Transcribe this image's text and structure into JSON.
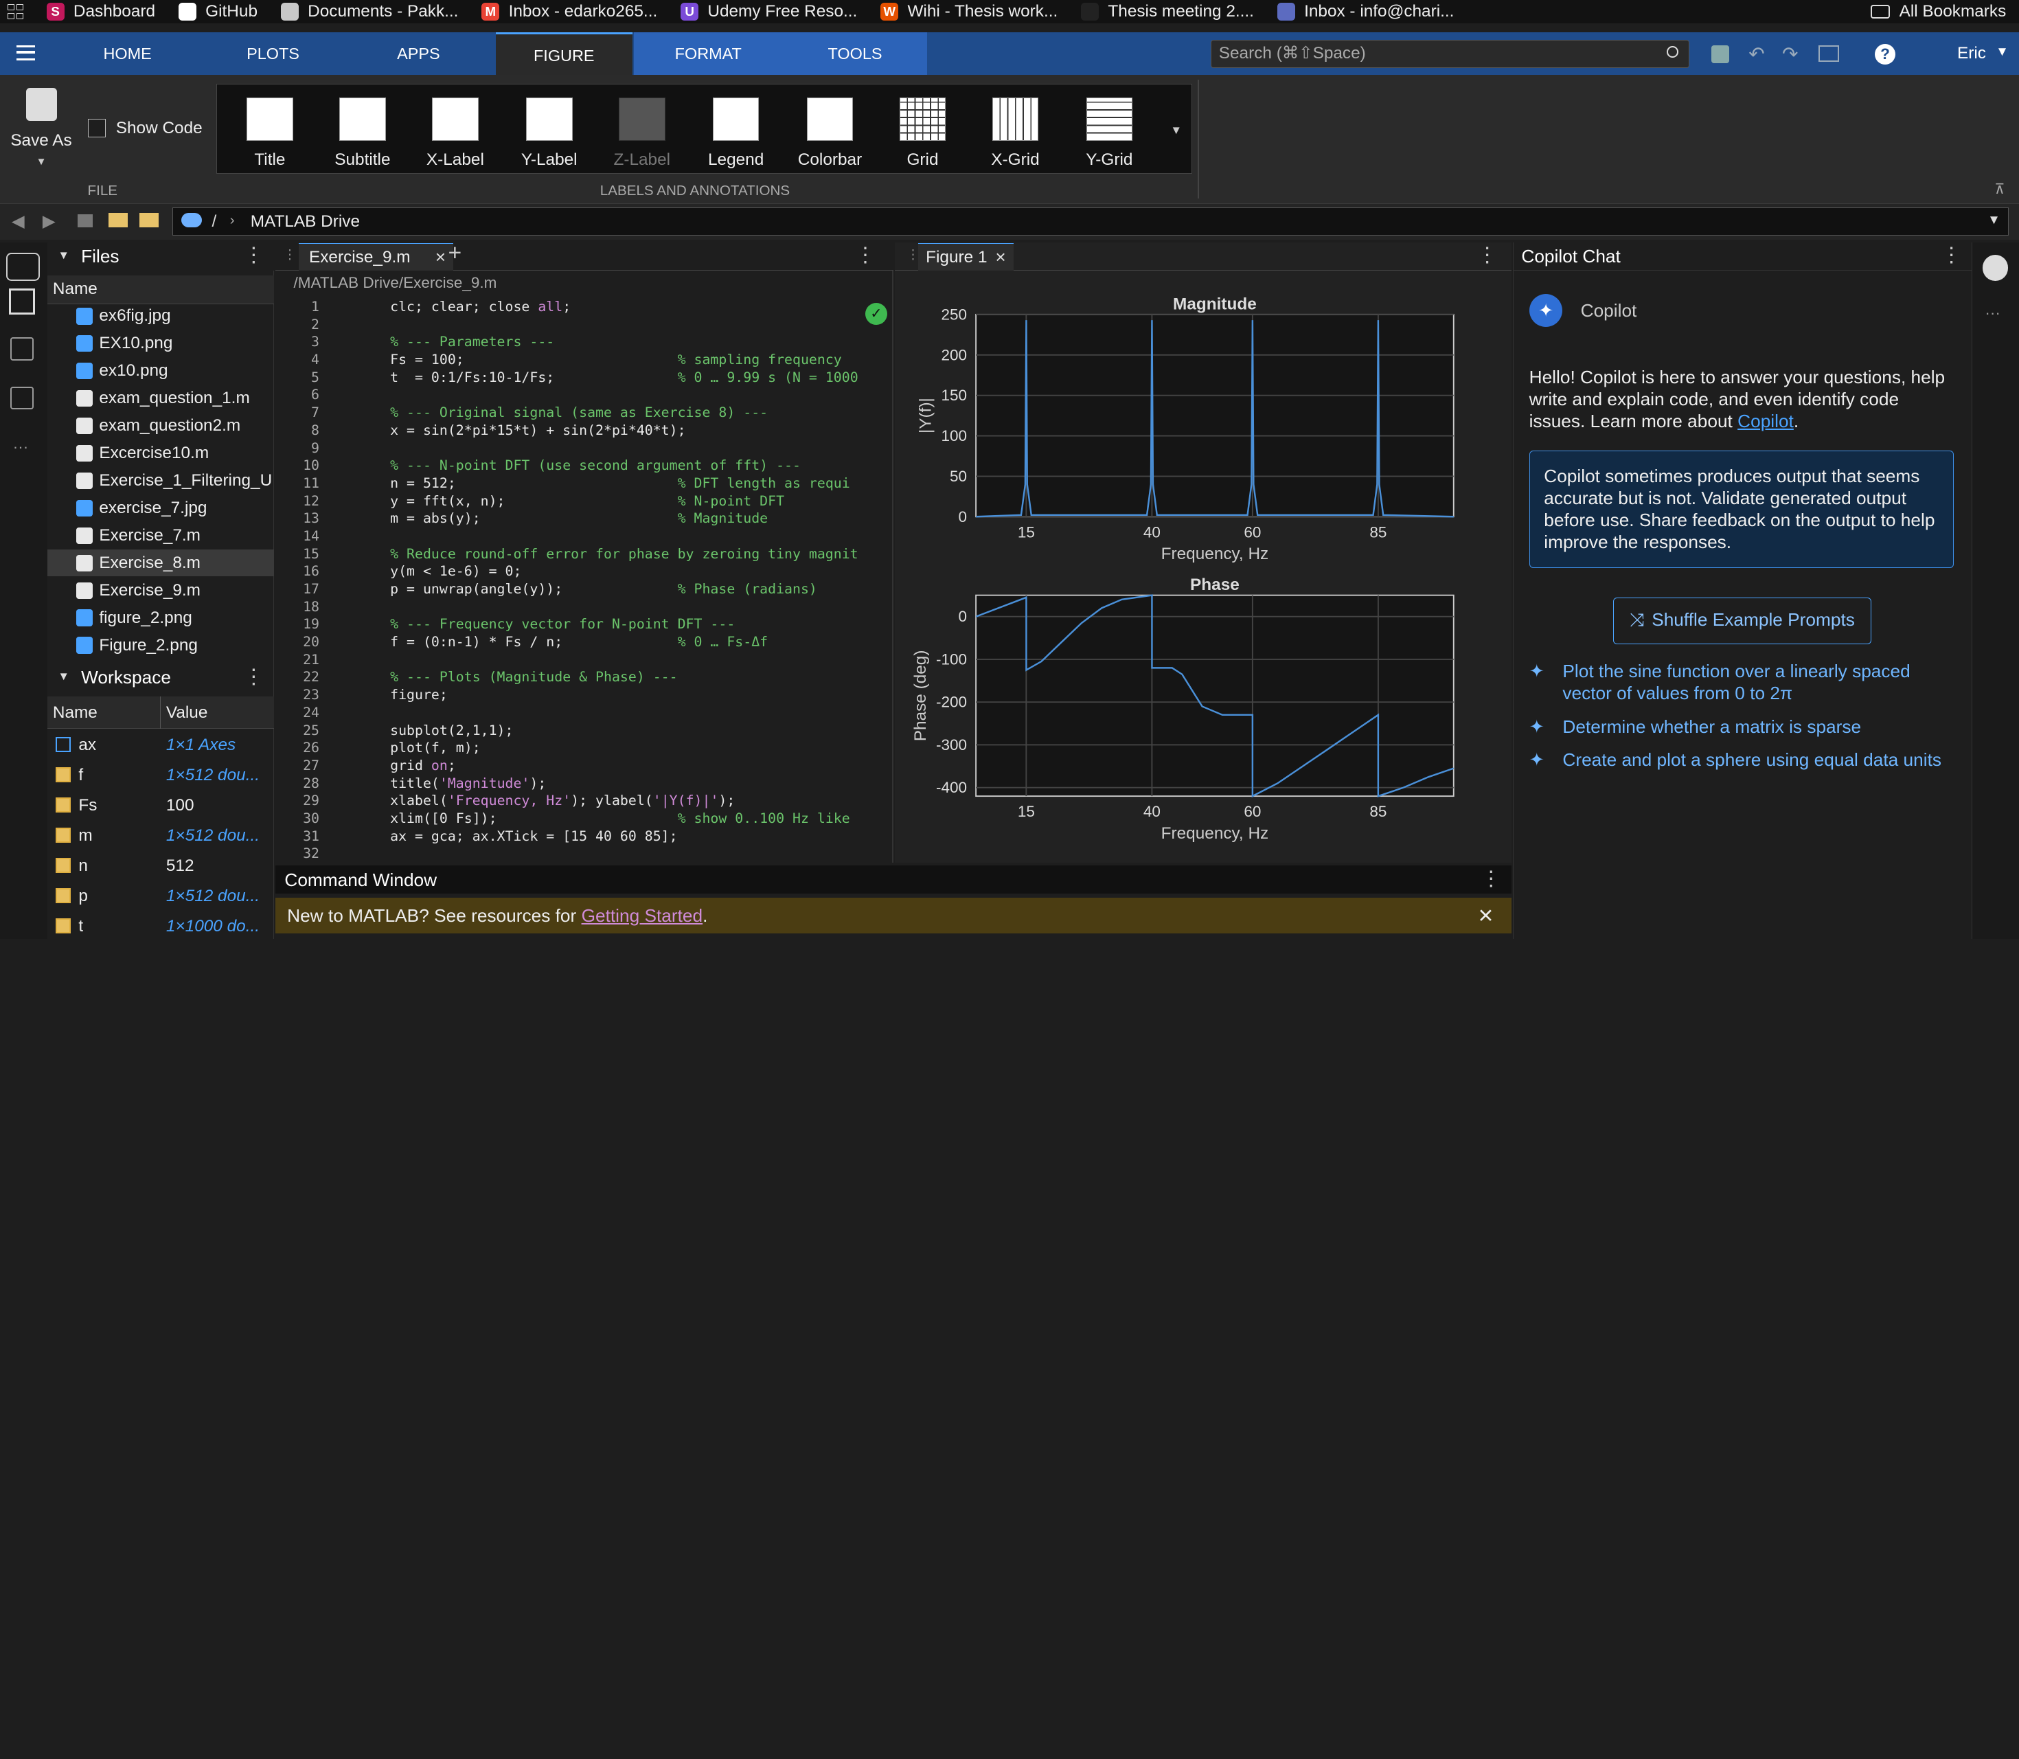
{
  "bookmarks": {
    "items": [
      {
        "label": "Dashboard",
        "icon": "dashboard-icon",
        "color": "#c2185b",
        "glyph": "S"
      },
      {
        "label": "GitHub",
        "icon": "github-icon",
        "color": "#ffffff",
        "glyph": ""
      },
      {
        "label": "Documents - Pakk...",
        "icon": "documents-icon",
        "color": "#c8c8c8",
        "glyph": ""
      },
      {
        "label": "Inbox - edarko265...",
        "icon": "gmail-icon",
        "color": "#ea4335",
        "glyph": "M"
      },
      {
        "label": "Udemy Free Reso...",
        "icon": "udemy-icon",
        "color": "#7b4bd8",
        "glyph": "U"
      },
      {
        "label": "Wihi - Thesis work...",
        "icon": "wihi-icon",
        "color": "#e65100",
        "glyph": "W"
      },
      {
        "label": "Thesis meeting 2....",
        "icon": "folder-icon",
        "color": "#222222",
        "glyph": ""
      },
      {
        "label": "Inbox - info@chari...",
        "icon": "mail-icon",
        "color": "#5c6bc0",
        "glyph": ""
      }
    ],
    "all_bookmarks": "All Bookmarks"
  },
  "toolstrip": {
    "tabs": [
      "HOME",
      "PLOTS",
      "APPS",
      "FIGURE",
      "FORMAT",
      "TOOLS"
    ],
    "search_placeholder": "Search (⌘⇧Space)",
    "user": "Eric"
  },
  "ribbon": {
    "save_as": "Save As",
    "show_code": "Show Code",
    "file_section": "FILE",
    "labels_section": "LABELS AND ANNOTATIONS",
    "gallery": [
      "Title",
      "Subtitle",
      "X-Label",
      "Y-Label",
      "Z-Label",
      "Legend",
      "Colorbar",
      "Grid",
      "X-Grid",
      "Y-Grid"
    ]
  },
  "address": {
    "sep": "/",
    "path": "MATLAB Drive"
  },
  "files": {
    "title": "Files",
    "col_name": "Name",
    "items": [
      {
        "name": "ex6fig.jpg",
        "type": "img"
      },
      {
        "name": "EX10.png",
        "type": "img"
      },
      {
        "name": "ex10.png",
        "type": "img"
      },
      {
        "name": "exam_question_1.m",
        "type": "m"
      },
      {
        "name": "exam_question2.m",
        "type": "m"
      },
      {
        "name": "Excercise10.m",
        "type": "m"
      },
      {
        "name": "Exercise_1_Filtering_U",
        "type": "m"
      },
      {
        "name": "exercise_7.jpg",
        "type": "img"
      },
      {
        "name": "Exercise_7.m",
        "type": "m"
      },
      {
        "name": "Exercise_8.m",
        "type": "m",
        "selected": true
      },
      {
        "name": "Exercise_9.m",
        "type": "m"
      },
      {
        "name": "figure_2.png",
        "type": "img"
      },
      {
        "name": "Figure_2.png",
        "type": "img"
      }
    ]
  },
  "workspace": {
    "title": "Workspace",
    "col_name": "Name",
    "col_value": "Value",
    "vars": [
      {
        "name": "ax",
        "value": "1×1 Axes",
        "link": true,
        "icon": "axes-icon"
      },
      {
        "name": "f",
        "value": "1×512 dou...",
        "link": true,
        "icon": "matrix-icon"
      },
      {
        "name": "Fs",
        "value": "100",
        "link": false,
        "icon": "matrix-icon"
      },
      {
        "name": "m",
        "value": "1×512 dou...",
        "link": true,
        "icon": "matrix-icon"
      },
      {
        "name": "n",
        "value": "512",
        "link": false,
        "icon": "matrix-icon"
      },
      {
        "name": "p",
        "value": "1×512 dou...",
        "link": true,
        "icon": "matrix-icon"
      },
      {
        "name": "t",
        "value": "1×1000 do...",
        "link": true,
        "icon": "matrix-icon"
      }
    ]
  },
  "editor": {
    "tab": "Exercise_9.m",
    "path": "/MATLAB Drive/Exercise_9.m",
    "lines": [
      [
        [
          "clc; clear; close ",
          ""
        ],
        [
          "all",
          "str"
        ],
        [
          ";",
          ""
        ]
      ],
      [],
      [
        [
          "% --- Parameters ---",
          "cm"
        ]
      ],
      [
        [
          "Fs = 100;                          ",
          ""
        ],
        [
          "% sampling frequency",
          "cm"
        ]
      ],
      [
        [
          "t  = 0:1/Fs:10-1/Fs;               ",
          ""
        ],
        [
          "% 0 … 9.99 s (N = 1000",
          "cm"
        ]
      ],
      [],
      [
        [
          "% --- Original signal (same as Exercise 8) ---",
          "cm"
        ]
      ],
      [
        [
          "x = sin(2*pi*15*t) + sin(2*pi*40*t);",
          ""
        ]
      ],
      [],
      [
        [
          "% --- N-point DFT (use second argument of fft) ---",
          "cm"
        ]
      ],
      [
        [
          "n = 512;                           ",
          ""
        ],
        [
          "% DFT length as requi",
          "cm"
        ]
      ],
      [
        [
          "y = fft(x, n);                     ",
          ""
        ],
        [
          "% N-point DFT",
          "cm"
        ]
      ],
      [
        [
          "m = abs(y);                        ",
          ""
        ],
        [
          "% Magnitude",
          "cm"
        ]
      ],
      [],
      [
        [
          "% Reduce round-off error for phase by zeroing tiny magnit",
          "cm"
        ]
      ],
      [
        [
          "y(m < 1e-6) = 0;",
          ""
        ]
      ],
      [
        [
          "p = unwrap(angle(y));              ",
          ""
        ],
        [
          "% Phase (radians)",
          "cm"
        ]
      ],
      [],
      [
        [
          "% --- Frequency vector for N-point DFT ---",
          "cm"
        ]
      ],
      [
        [
          "f = (0:n-1) * Fs / n;              ",
          ""
        ],
        [
          "% 0 … Fs-Δf",
          "cm"
        ]
      ],
      [],
      [
        [
          "% --- Plots (Magnitude & Phase) ---",
          "cm"
        ]
      ],
      [
        [
          "figure;",
          ""
        ]
      ],
      [],
      [
        [
          "subplot(2,1,1);",
          ""
        ]
      ],
      [
        [
          "plot(f, m);",
          ""
        ]
      ],
      [
        [
          "grid ",
          ""
        ],
        [
          "on",
          "str"
        ],
        [
          ";",
          ""
        ]
      ],
      [
        [
          "title(",
          ""
        ],
        [
          "'Magnitude'",
          "str"
        ],
        [
          ");",
          ""
        ]
      ],
      [
        [
          "xlabel(",
          ""
        ],
        [
          "'Frequency, Hz'",
          "str"
        ],
        [
          "); ylabel(",
          ""
        ],
        [
          "'|Y(f)|'",
          "str"
        ],
        [
          ");",
          ""
        ]
      ],
      [
        [
          "xlim([0 Fs]);                      ",
          ""
        ],
        [
          "% show 0..100 Hz like",
          "cm"
        ]
      ],
      [
        [
          "ax = gca; ax.XTick = [15 40 60 85];",
          ""
        ]
      ],
      []
    ]
  },
  "figure": {
    "tab": "Figure 1"
  },
  "chart_data": [
    {
      "type": "line",
      "title": "Magnitude",
      "xlabel": "Frequency, Hz",
      "ylabel": "|Y(f)|",
      "xlim": [
        5,
        100
      ],
      "ylim": [
        0,
        250
      ],
      "xticks": [
        15,
        40,
        60,
        85
      ],
      "yticks": [
        0,
        50,
        100,
        150,
        200,
        250
      ],
      "grid": true,
      "series": [
        {
          "color": "#4a90d9",
          "x": [
            5,
            14,
            14.8,
            15,
            15.2,
            16,
            39,
            39.8,
            40,
            40.2,
            41,
            59,
            59.8,
            60,
            60.2,
            61,
            84,
            84.8,
            85,
            85.2,
            86,
            100
          ],
          "y": [
            0,
            2,
            40,
            243,
            40,
            2,
            2,
            40,
            243,
            40,
            2,
            2,
            40,
            243,
            40,
            2,
            2,
            40,
            243,
            40,
            2,
            0
          ]
        }
      ]
    },
    {
      "type": "line",
      "title": "Phase",
      "xlabel": "Frequency, Hz",
      "ylabel": "Phase (deg)",
      "xlim": [
        5,
        100
      ],
      "ylim": [
        -420,
        50
      ],
      "xticks": [
        15,
        40,
        60,
        85
      ],
      "yticks": [
        0,
        -100,
        -200,
        -300,
        -400
      ],
      "grid": true,
      "series": [
        {
          "color": "#4a90d9",
          "x": [
            5,
            15,
            15,
            18,
            22,
            26,
            30,
            34,
            40,
            40,
            44,
            46,
            50,
            54,
            57,
            60,
            60,
            65,
            70,
            75,
            80,
            85,
            85,
            90,
            95,
            100
          ],
          "y": [
            0,
            45,
            -125,
            -105,
            -60,
            -15,
            20,
            40,
            50,
            -120,
            -120,
            -135,
            -210,
            -230,
            -230,
            -230,
            -420,
            -390,
            -350,
            -310,
            -270,
            -230,
            -420,
            -400,
            -375,
            -355
          ]
        }
      ]
    }
  ],
  "copilot": {
    "title": "Copilot Chat",
    "name": "Copilot",
    "intro": "Hello! Copilot is here to answer your questions, help write and explain code, and even identify code issues. Learn more about ",
    "intro_link": "Copilot",
    "intro_end": ".",
    "notice": "Copilot sometimes produces output that seems accurate but is not. Validate generated output before use. Share feedback on the output to help improve the responses.",
    "shuffle": "Shuffle Example Prompts",
    "prompts": [
      "Plot the sine function over a linearly spaced vector of values from 0 to 2π",
      "Determine whether a matrix is sparse",
      "Create and plot a sphere using equal data units"
    ]
  },
  "command_window": {
    "title": "Command Window",
    "banner": "New to MATLAB? See resources for ",
    "banner_link": "Getting Started",
    "banner_end": "."
  }
}
